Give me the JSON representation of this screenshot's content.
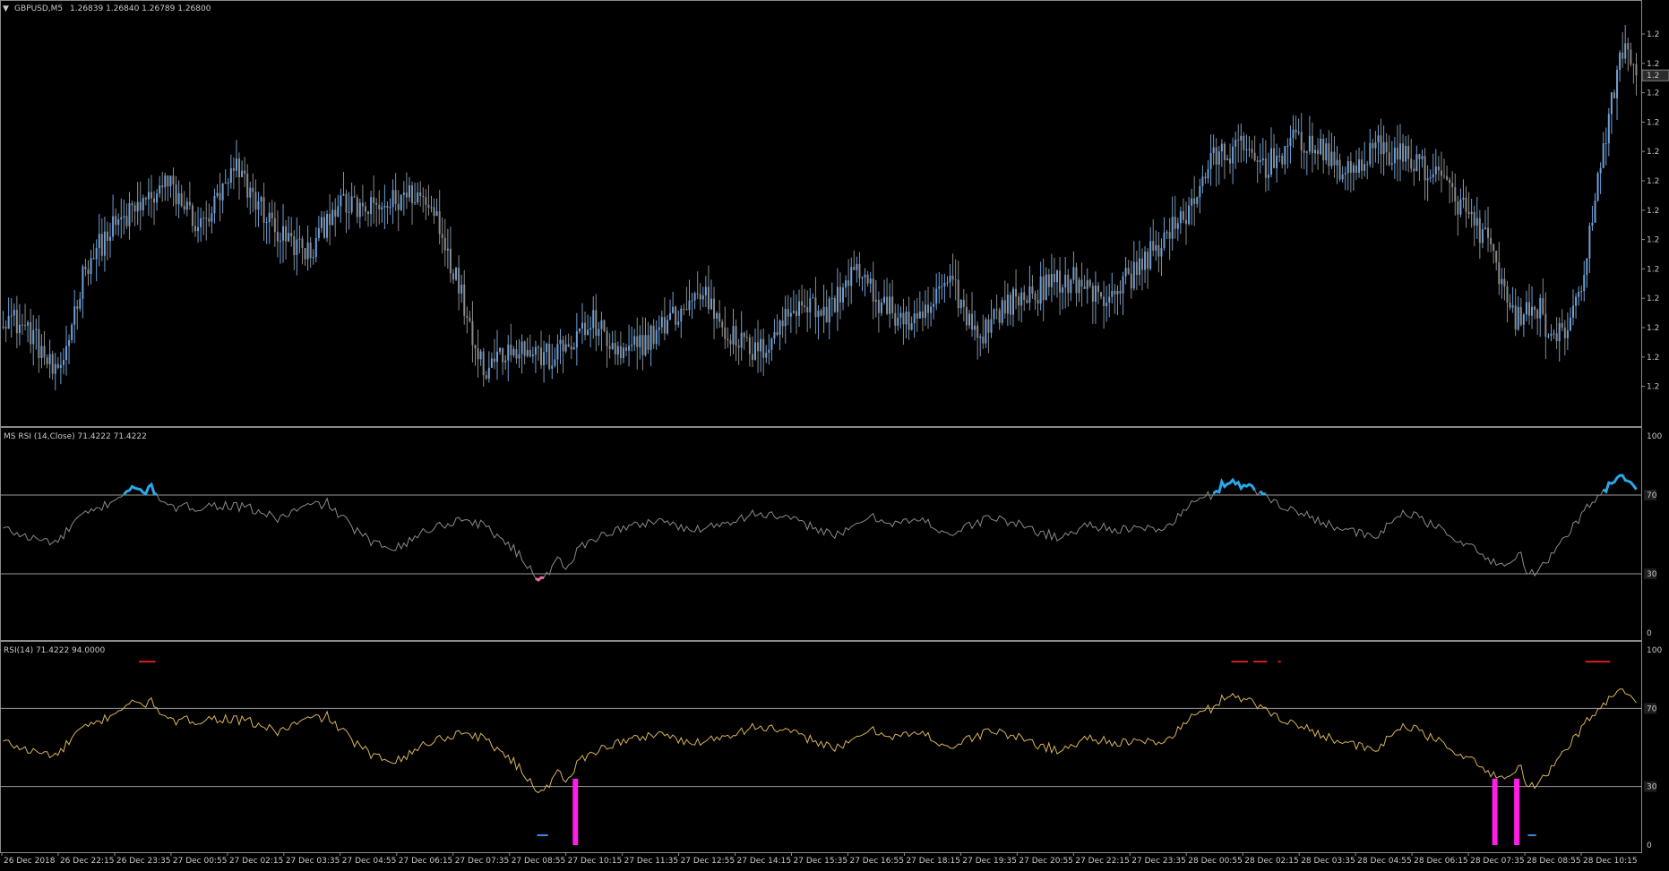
{
  "colors": {
    "background": "#000000",
    "border": "#8a8a8a",
    "text": "#c8c8c8",
    "bull_candle": "#6f9fd6",
    "bear_candle": "#8a8a8a",
    "rsi_line": "#8a8a8a",
    "rsi_overbought": "#29a9e9",
    "rsi_oversold": "#e86ba1",
    "rsi2_line": "#d8b45a",
    "level_line": "#9a9a9a",
    "hist_magenta": "#ff1ee6",
    "marker_red": "#d42020",
    "marker_blue": "#3b88e6"
  },
  "main_panel": {
    "header_arrow": "▼",
    "symbol": "GBPUSD,M5",
    "ohlc": "1.26839 1.26840 1.26789 1.26800",
    "price_ticks": [
      "1.2",
      "1.2",
      "1.2",
      "1.2",
      "1.2",
      "1.2",
      "1.2",
      "1.2",
      "1.2",
      "1.2",
      "1.2",
      "1.2",
      "1.2"
    ],
    "current_price_label": "1.2"
  },
  "rsi_panel_1": {
    "title": "MS RSI (14,Close) 71.4222 71.4222",
    "scale_labels": [
      "100",
      "70",
      "30",
      "0"
    ]
  },
  "rsi_panel_2": {
    "title": "RSI(14) 71.4222 94.0000",
    "scale_labels": [
      "100",
      "70",
      "30",
      "0"
    ]
  },
  "time_axis": {
    "labels": [
      "26 Dec 2018",
      "26 Dec 22:15",
      "26 Dec 23:35",
      "27 Dec 00:55",
      "27 Dec 02:15",
      "27 Dec 03:35",
      "27 Dec 04:55",
      "27 Dec 06:15",
      "27 Dec 07:35",
      "27 Dec 08:55",
      "27 Dec 10:15",
      "27 Dec 11:35",
      "27 Dec 12:55",
      "27 Dec 14:15",
      "27 Dec 15:35",
      "27 Dec 16:55",
      "27 Dec 18:15",
      "27 Dec 19:35",
      "27 Dec 20:55",
      "27 Dec 22:15",
      "27 Dec 23:35",
      "28 Dec 00:55",
      "28 Dec 02:15",
      "28 Dec 03:35",
      "28 Dec 04:55",
      "28 Dec 06:15",
      "28 Dec 07:35",
      "28 Dec 08:55",
      "28 Dec 10:15"
    ]
  },
  "chart_data": [
    {
      "type": "candlestick",
      "title": "GBPUSD,M5",
      "price_anchors": [
        [
          0,
          1.2645
        ],
        [
          10,
          1.2641
        ],
        [
          20,
          1.263
        ],
        [
          30,
          1.2656
        ],
        [
          40,
          1.2664
        ],
        [
          60,
          1.2674
        ],
        [
          72,
          1.2664
        ],
        [
          85,
          1.2677
        ],
        [
          100,
          1.2663
        ],
        [
          112,
          1.2658
        ],
        [
          120,
          1.2669
        ],
        [
          135,
          1.2668
        ],
        [
          150,
          1.2672
        ],
        [
          158,
          1.2667
        ],
        [
          170,
          1.2643
        ],
        [
          175,
          1.2633
        ],
        [
          185,
          1.2638
        ],
        [
          200,
          1.2635
        ],
        [
          215,
          1.2643
        ],
        [
          225,
          1.2635
        ],
        [
          240,
          1.2642
        ],
        [
          255,
          1.265
        ],
        [
          265,
          1.264
        ],
        [
          275,
          1.2636
        ],
        [
          290,
          1.2648
        ],
        [
          300,
          1.2645
        ],
        [
          310,
          1.2655
        ],
        [
          320,
          1.2647
        ],
        [
          333,
          1.2642
        ],
        [
          345,
          1.2653
        ],
        [
          355,
          1.264
        ],
        [
          365,
          1.2647
        ],
        [
          380,
          1.2651
        ],
        [
          390,
          1.2653
        ],
        [
          400,
          1.2648
        ],
        [
          412,
          1.2654
        ],
        [
          420,
          1.266
        ],
        [
          430,
          1.2666
        ],
        [
          440,
          1.2679
        ],
        [
          450,
          1.2682
        ],
        [
          460,
          1.2678
        ],
        [
          472,
          1.2684
        ],
        [
          480,
          1.2681
        ],
        [
          490,
          1.2676
        ],
        [
          500,
          1.2682
        ],
        [
          515,
          1.2679
        ],
        [
          525,
          1.2674
        ],
        [
          540,
          1.2662
        ],
        [
          550,
          1.2644
        ],
        [
          560,
          1.2646
        ],
        [
          565,
          1.2638
        ],
        [
          575,
          1.2648
        ],
        [
          580,
          1.2672
        ],
        [
          585,
          1.2689
        ],
        [
          590,
          1.2704
        ],
        [
          595,
          1.2699
        ]
      ],
      "candle_count": 596,
      "seed": 12345
    },
    {
      "type": "line",
      "title": "MS RSI (14,Close) 71.4222 71.4222",
      "levels": [
        70,
        30
      ],
      "ylim": [
        0,
        100
      ],
      "value_anchors": [
        [
          0,
          53
        ],
        [
          10,
          48
        ],
        [
          20,
          46
        ],
        [
          27,
          58
        ],
        [
          35,
          63
        ],
        [
          45,
          72
        ],
        [
          55,
          73
        ],
        [
          60,
          63
        ],
        [
          70,
          64
        ],
        [
          80,
          65
        ],
        [
          90,
          63
        ],
        [
          100,
          58
        ],
        [
          110,
          64
        ],
        [
          118,
          66
        ],
        [
          126,
          55
        ],
        [
          135,
          45
        ],
        [
          142,
          44
        ],
        [
          148,
          46
        ],
        [
          152,
          51
        ],
        [
          160,
          55
        ],
        [
          168,
          58
        ],
        [
          176,
          54
        ],
        [
          185,
          44
        ],
        [
          195,
          28
        ],
        [
          200,
          32
        ],
        [
          203,
          40
        ],
        [
          205,
          30
        ],
        [
          210,
          44
        ],
        [
          220,
          51
        ],
        [
          232,
          55
        ],
        [
          240,
          58
        ],
        [
          248,
          52
        ],
        [
          260,
          55
        ],
        [
          275,
          61
        ],
        [
          285,
          58
        ],
        [
          295,
          54
        ],
        [
          305,
          49
        ],
        [
          315,
          59
        ],
        [
          325,
          56
        ],
        [
          335,
          57
        ],
        [
          345,
          50
        ],
        [
          360,
          59
        ],
        [
          372,
          54
        ],
        [
          385,
          48
        ],
        [
          395,
          55
        ],
        [
          410,
          52
        ],
        [
          425,
          54
        ],
        [
          432,
          65
        ],
        [
          440,
          70
        ],
        [
          447,
          78
        ],
        [
          455,
          73
        ],
        [
          462,
          68
        ],
        [
          470,
          62
        ],
        [
          480,
          57
        ],
        [
          490,
          52
        ],
        [
          500,
          48
        ],
        [
          510,
          62
        ],
        [
          520,
          55
        ],
        [
          530,
          48
        ],
        [
          540,
          38
        ],
        [
          548,
          34
        ],
        [
          553,
          40
        ],
        [
          556,
          29
        ],
        [
          560,
          32
        ],
        [
          568,
          46
        ],
        [
          575,
          60
        ],
        [
          580,
          68
        ],
        [
          587,
          78
        ],
        [
          592,
          79
        ],
        [
          595,
          71
        ]
      ],
      "ob_level": 70,
      "os_level": 30
    },
    {
      "type": "line",
      "title": "RSI(14) 71.4222 94.0000",
      "levels": [
        70,
        30
      ],
      "ylim": [
        0,
        100
      ],
      "histogram": [
        {
          "at": 208,
          "value": 34
        },
        {
          "at": 543,
          "value": 34
        },
        {
          "at": 551,
          "value": 34
        }
      ],
      "red_markers": [
        [
          50,
          56
        ],
        [
          448,
          454
        ],
        [
          456,
          461
        ],
        [
          465,
          466
        ],
        [
          577,
          586
        ]
      ],
      "blue_markers": [
        [
          195,
          199
        ],
        [
          556,
          559
        ]
      ]
    }
  ]
}
